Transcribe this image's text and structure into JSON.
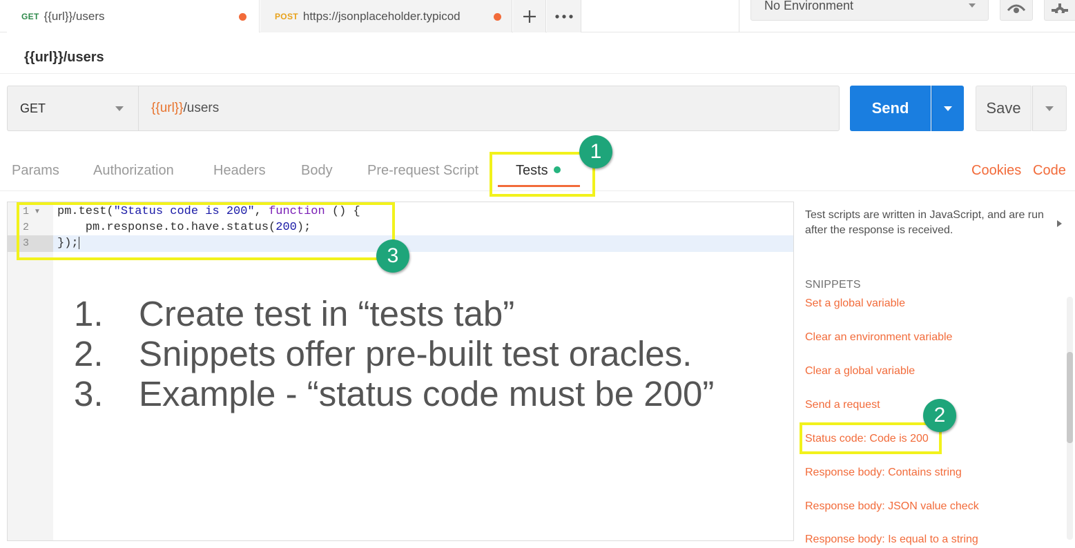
{
  "tabs": [
    {
      "method": "GET",
      "title": "{{url}}/users",
      "unsaved": true
    },
    {
      "method": "POST",
      "title": "https://jsonplaceholder.typicod",
      "unsaved": true
    }
  ],
  "tab_actions": {
    "new_tab_icon": "plus-icon",
    "more_icon": "ellipsis-icon"
  },
  "environment": {
    "selected": "No Environment",
    "eye_icon": "eye-icon",
    "settings_icon": "gear-icon"
  },
  "request": {
    "name": "{{url}}/users",
    "method": "GET",
    "url_variable": "{{url}}",
    "url_path": "/users"
  },
  "buttons": {
    "send": "Send",
    "save": "Save"
  },
  "subtabs": [
    "Params",
    "Authorization",
    "Headers",
    "Body",
    "Pre-request Script",
    "Tests"
  ],
  "active_subtab": "Tests",
  "subtab_links": {
    "cookies": "Cookies",
    "code": "Code"
  },
  "editor": {
    "line_numbers": [
      "1",
      "2",
      "3"
    ],
    "line1": {
      "a": "pm.test(",
      "str": "\"Status code is 200\"",
      "b": ", ",
      "kw": "function",
      "c": " () {"
    },
    "line2": {
      "a": "    pm.response.to.have.status(",
      "num": "200",
      "b": ");"
    },
    "line3": "});"
  },
  "notes": [
    {
      "num": "1.",
      "text": "Create test in “tests tab”"
    },
    {
      "num": "2.",
      "text": "Snippets offer pre-built test oracles."
    },
    {
      "num": "3.",
      "text": "Example - “status code must be 200”"
    }
  ],
  "side_panel": {
    "description": "Test scripts are written in JavaScript, and are run after the response is received.",
    "snippets_heading": "SNIPPETS",
    "snippets": [
      "Set a global variable",
      "Clear an environment variable",
      "Clear a global variable",
      "Send a request",
      "Status code: Code is 200",
      "Response body: Contains string",
      "Response body: JSON value check",
      "Response body: Is equal to a string"
    ]
  },
  "badges": [
    "1",
    "2",
    "3"
  ],
  "colors": {
    "accent": "#f26b3a",
    "send": "#1a7ee0",
    "highlight": "#f2f21c",
    "badge": "#1ea57a",
    "tests_dot": "#26b47f"
  }
}
